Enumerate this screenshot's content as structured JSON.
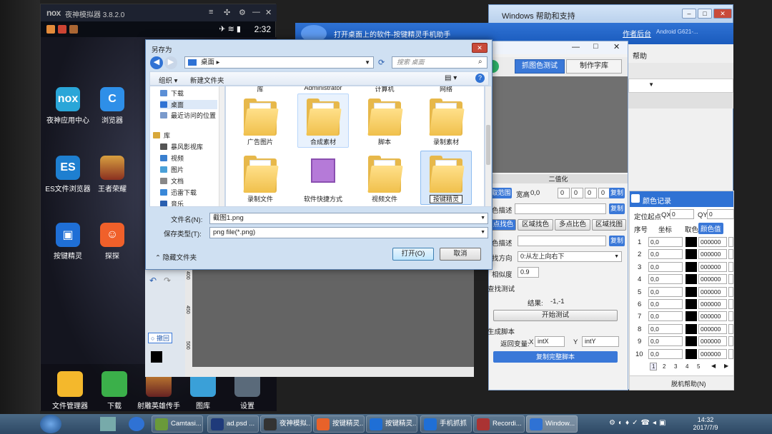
{
  "emulator": {
    "title": "夜神模拟器 3.8.2.0",
    "time": "2:32",
    "apps": [
      {
        "label": "夜神应用中心",
        "icon": "nox"
      },
      {
        "label": "浏览器",
        "icon": "browser"
      },
      {
        "label": "ES文件浏览器",
        "icon": "es-file"
      },
      {
        "label": "王者荣耀",
        "icon": "game-hero"
      },
      {
        "label": "按键精灵",
        "icon": "anjian"
      },
      {
        "label": "探探",
        "icon": "tantan"
      }
    ],
    "dock": [
      {
        "label": "文件管理器"
      },
      {
        "label": "下载"
      },
      {
        "label": "射雕英雄传手"
      },
      {
        "label": "图库"
      },
      {
        "label": "设置"
      }
    ]
  },
  "help_window": {
    "title": "Windows 帮助和支持"
  },
  "jingling_header": {
    "title": "打开桌面上的软件-按键精灵手机助手",
    "link": "作者后台",
    "device": "Android G621-...",
    "help_tab": "帮助"
  },
  "tool": {
    "tabs": [
      "抓图色测试",
      "制作字库"
    ],
    "section_binarize": "二值化",
    "label_range": "取范围",
    "label_wh": "宽高",
    "wh_value": "0,0",
    "range_values": [
      "0",
      "0",
      "0",
      "0"
    ],
    "copy": "复制",
    "label_desc1": "色描述",
    "subtabs": [
      "点找色",
      "区域找色",
      "多点比色",
      "区域找图"
    ],
    "label_desc2": "色描述",
    "label_dir": "找方向",
    "dir_value": "0:从左上向右下",
    "label_sim": "相似度",
    "sim_value": "0.9",
    "section_test": "查找测试",
    "result_label": "结果:",
    "result_value": "-1,-1",
    "start_test": "开始测试",
    "section_gen": "生成脚本",
    "return_var": "返回变量:",
    "x_label": "X",
    "x_value": "intX",
    "y_label": "Y",
    "y_value": "intY",
    "copy_full": "复制完整脚本"
  },
  "color_panel": {
    "title": "颜色记录",
    "origin_label": "定位起点",
    "qx_label": "QX",
    "qx_value": "0",
    "qy_label": "QY",
    "qy_value": "0",
    "col_no": "序号",
    "col_coord": "坐标",
    "col_pick": "取色",
    "col_color": "颜色值",
    "rows": [
      {
        "no": "1",
        "coord": "0,0",
        "color": "000000"
      },
      {
        "no": "2",
        "coord": "0,0",
        "color": "000000"
      },
      {
        "no": "3",
        "coord": "0,0",
        "color": "000000"
      },
      {
        "no": "4",
        "coord": "0,0",
        "color": "000000"
      },
      {
        "no": "5",
        "coord": "0,0",
        "color": "000000"
      },
      {
        "no": "6",
        "coord": "0,0",
        "color": "000000"
      },
      {
        "no": "7",
        "coord": "0,0",
        "color": "000000"
      },
      {
        "no": "8",
        "coord": "0,0",
        "color": "000000"
      },
      {
        "no": "9",
        "coord": "0,0",
        "color": "000000"
      },
      {
        "no": "10",
        "coord": "0,0",
        "color": "000000"
      }
    ],
    "pages": [
      "1",
      "2",
      "3",
      "4",
      "5"
    ],
    "footer": "脱机帮助(N)"
  },
  "dialog": {
    "title": "另存为",
    "address": "桌面",
    "search_placeholder": "搜索 桌面",
    "organize": "组织",
    "new_folder": "新建文件夹",
    "nav_items": [
      {
        "label": "下载",
        "icon": "download-folder"
      },
      {
        "label": "桌面",
        "icon": "desktop"
      },
      {
        "label": "最近访问的位置",
        "icon": "recent"
      },
      {
        "label": "库",
        "icon": "library"
      },
      {
        "label": "暴风影视库",
        "icon": "video-lib"
      },
      {
        "label": "视频",
        "icon": "video"
      },
      {
        "label": "图片",
        "icon": "picture"
      },
      {
        "label": "文档",
        "icon": "document"
      },
      {
        "label": "迅雷下载",
        "icon": "thunder"
      },
      {
        "label": "音乐",
        "icon": "music"
      }
    ],
    "top_labels": [
      "库",
      "Administrator",
      "计算机",
      "网络"
    ],
    "files": [
      {
        "label": "广告图片"
      },
      {
        "label": "合成素材"
      },
      {
        "label": "脚本"
      },
      {
        "label": "录制素材"
      },
      {
        "label": "录制文件"
      },
      {
        "label": "软件快捷方式"
      },
      {
        "label": "视频文件"
      },
      {
        "label": "按键精灵"
      }
    ],
    "filename_label": "文件名(N):",
    "filename_value": "截图1.png",
    "filetype_label": "保存类型(T):",
    "filetype_value": "png file(*.png)",
    "hide_folders": "隐藏文件夹",
    "open_button": "打开(O)",
    "cancel_button": "取消"
  },
  "ps_canvas": {
    "undo_label": "撤回",
    "ruler_marks": [
      "400",
      "450",
      "500"
    ]
  },
  "taskbar": {
    "items": [
      {
        "label": "Camtasi..."
      },
      {
        "label": "ad.psd ..."
      },
      {
        "label": "夜神模拟..."
      },
      {
        "label": "按键精灵..."
      },
      {
        "label": "按键精灵..."
      },
      {
        "label": "手机抓抓"
      },
      {
        "label": "Recordi..."
      },
      {
        "label": "Window..."
      }
    ],
    "time": "14:32",
    "date": "2017/7/9"
  }
}
